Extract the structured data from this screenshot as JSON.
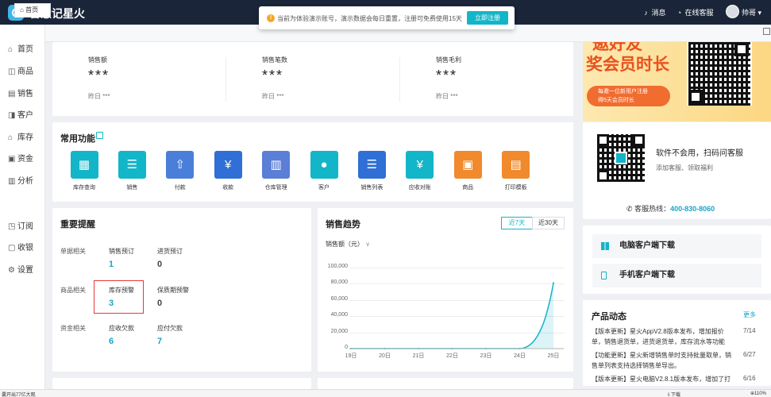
{
  "topbar": {
    "brand": "智慧记星火",
    "notice_text": "当前为体验演示账号，演示数据会每日重置，注册可免费使用15天",
    "register_button": "立即注册",
    "messages": "消息",
    "support": "在线客服",
    "user": "帅哥"
  },
  "sidebar": {
    "items": [
      {
        "icon": "home-icon",
        "label": "首页"
      },
      {
        "icon": "goods-icon",
        "label": "商品"
      },
      {
        "icon": "sales-icon",
        "label": "销售"
      },
      {
        "icon": "customer-icon",
        "label": "客户"
      },
      {
        "icon": "inventory-icon",
        "label": "库存"
      },
      {
        "icon": "funds-icon",
        "label": "资金"
      },
      {
        "icon": "analysis-icon",
        "label": "分析"
      },
      {
        "icon": "order-icon",
        "label": "订阅"
      },
      {
        "icon": "collection-icon",
        "label": "收银"
      },
      {
        "icon": "settings-icon",
        "label": "设置"
      }
    ]
  },
  "tabs": {
    "home": "首页"
  },
  "stats": [
    {
      "label": "销售额",
      "value": "***",
      "sub": "昨日 ***"
    },
    {
      "label": "销售笔数",
      "value": "***",
      "sub": "昨日 ***"
    },
    {
      "label": "销售毛利",
      "value": "***",
      "sub": "昨日 ***"
    }
  ],
  "functions": {
    "title": "常用功能",
    "items": [
      {
        "label": "库存查询",
        "color": "#13b5c8",
        "icon": "warehouse-icon",
        "glyph": "▦"
      },
      {
        "label": "销售",
        "color": "#13b5c8",
        "icon": "document-icon",
        "glyph": "☰"
      },
      {
        "label": "付款",
        "color": "#4a7fd9",
        "icon": "upload-icon",
        "glyph": "⇧"
      },
      {
        "label": "收款",
        "color": "#2f6fd6",
        "icon": "yen-icon",
        "glyph": "¥"
      },
      {
        "label": "仓库管理",
        "color": "#5b7fd6",
        "icon": "building-icon",
        "glyph": "▥"
      },
      {
        "label": "客户",
        "color": "#13b5c8",
        "icon": "person-icon",
        "glyph": "●"
      },
      {
        "label": "销售列表",
        "color": "#2f6fd6",
        "icon": "list-icon",
        "glyph": "☰"
      },
      {
        "label": "应收对账",
        "color": "#13b5c8",
        "icon": "reconcile-icon",
        "glyph": "¥"
      },
      {
        "label": "商品",
        "color": "#f08a2c",
        "icon": "bag-icon",
        "glyph": "▣"
      },
      {
        "label": "打印模板",
        "color": "#f08a2c",
        "icon": "printer-icon",
        "glyph": "▤"
      }
    ]
  },
  "reminders": {
    "title": "重要提醒",
    "rows": [
      {
        "group": "单据相关",
        "items": [
          {
            "name": "销售预订",
            "value": "1"
          },
          {
            "name": "进货预订",
            "value": "0"
          }
        ]
      },
      {
        "group": "商品相关",
        "items": [
          {
            "name": "库存预警",
            "value": "3"
          },
          {
            "name": "保质期预警",
            "value": "0"
          }
        ]
      },
      {
        "group": "资金相关",
        "items": [
          {
            "name": "应收欠款",
            "value": "6"
          },
          {
            "name": "应付欠款",
            "value": "7"
          }
        ]
      }
    ]
  },
  "trend": {
    "title": "销售趋势",
    "range_7": "近7天",
    "range_30": "近30天",
    "metric_select": "销售额（元）"
  },
  "chart_data": {
    "type": "line",
    "title": "",
    "xlabel": "",
    "ylabel": "",
    "categories": [
      "19日",
      "20日",
      "21日",
      "22日",
      "23日",
      "24日",
      "25日"
    ],
    "x_ticks": [
      "19日",
      "20日",
      "21日",
      "22日",
      "23日",
      "24日",
      "25日"
    ],
    "y_ticks": [
      "0",
      "20,000",
      "40,000",
      "60,000",
      "80,000",
      "100,000"
    ],
    "ylim": [
      0,
      100000
    ],
    "series": [
      {
        "values": [
          0,
          0,
          0,
          0,
          0,
          0,
          81000
        ],
        "color": "#13b5c8"
      }
    ],
    "area": true,
    "grid": true
  },
  "promo": {
    "headline1": "邀好友",
    "headline2": "奖会员时长",
    "pill_line1": "每邀一位新用户注册",
    "pill_line2": "得5天会员时长"
  },
  "service": {
    "title": "软件不会用，扫码问客服",
    "subtitle": "添加客服、领取福利",
    "hotline_label": "客服热线：",
    "hotline": "400-830-8060"
  },
  "downloads": {
    "pc": "电脑客户端下载",
    "mobile": "手机客户端下载"
  },
  "news": {
    "title": "产品动态",
    "more": "更多",
    "items": [
      {
        "line1": "【版本更新】星火AppV2.8版本发布，增加报价",
        "line2": "单，销售退货单，进货退货单，库存流水等功能",
        "date": "7/14"
      },
      {
        "line1": "【功能更新】星火新增销售单时支持批量取单，销",
        "line2": "售单列表支持选择销售单导出。",
        "date": "6/27"
      },
      {
        "line1": "【版本更新】星火电脑V2.8.1版本发布，增加了打",
        "line2": "",
        "date": "6/16"
      }
    ]
  },
  "statusbar": {
    "left": "囊开出77亿大观",
    "download": "下载",
    "zoom": "110%"
  }
}
